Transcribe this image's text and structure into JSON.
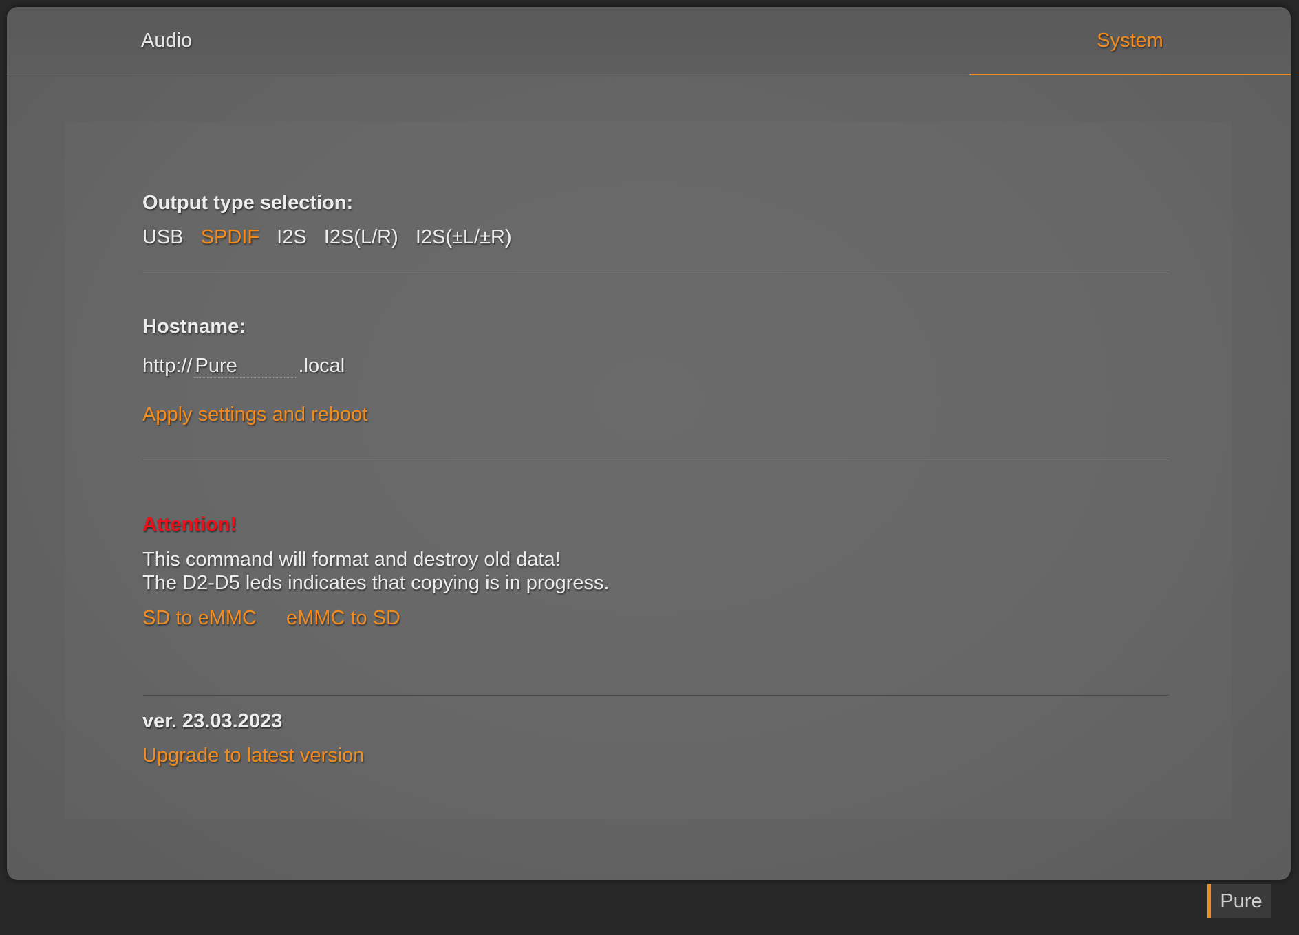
{
  "tabs": {
    "audio": "Audio",
    "system": "System"
  },
  "output": {
    "label": "Output type selection:",
    "options": [
      "USB",
      "SPDIF",
      "I2S",
      "I2S(L/R)",
      "I2S(±L/±R)"
    ],
    "selected": "SPDIF"
  },
  "hostname": {
    "label": "Hostname:",
    "prefix": "http://",
    "value": "Pure",
    "suffix": ".local",
    "apply_link": "Apply settings and reboot"
  },
  "format": {
    "attention": "Attention!",
    "line1": "This command will format and destroy old data!",
    "line2": "The D2-D5 leds indicates that copying is in progress.",
    "sd_to_emmc": "SD to eMMC",
    "emmc_to_sd": "eMMC to SD"
  },
  "version": {
    "label": "ver. 23.03.2023",
    "upgrade_link": "Upgrade to latest version"
  },
  "footer_badge": "Pure",
  "colors": {
    "accent": "#f28b1e",
    "warning": "#e8121a"
  }
}
